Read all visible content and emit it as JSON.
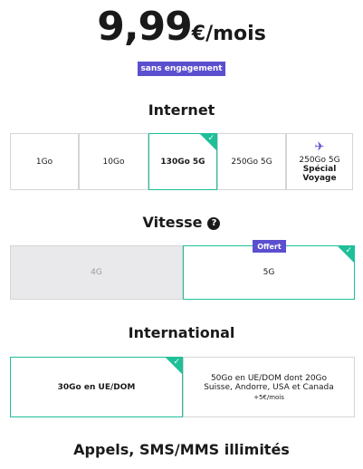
{
  "price": {
    "amount": "9,99",
    "unit": "€/mois"
  },
  "badge": "sans engagement",
  "internet": {
    "title": "Internet",
    "options": [
      {
        "label": "1Go"
      },
      {
        "label": "10Go"
      },
      {
        "label": "130Go 5G"
      },
      {
        "label": "250Go 5G",
        "sublabel": "Spécial Voyage",
        "icon": "airplane-icon"
      }
    ],
    "selected": "130Go 5G"
  },
  "vitesse": {
    "title": "Vitesse",
    "help_icon": "?",
    "offert_label": "Offert",
    "options": [
      {
        "label": "4G",
        "state": "disabled"
      },
      {
        "label": "5G",
        "state": "selected"
      }
    ]
  },
  "international": {
    "title": "International",
    "options": [
      {
        "label": "30Go en UE/DOM",
        "state": "selected"
      },
      {
        "label_line1": "50Go en UE/DOM dont 20Go",
        "label_line2": "Suisse, Andorre, USA et Canada",
        "price": "+5€/mois"
      }
    ]
  },
  "footer_title": "Appels, SMS/MMS illimités",
  "colors": {
    "accent": "#1fbf9a",
    "brand": "#5b4fcf",
    "disabled_bg": "#e9e9eb"
  }
}
